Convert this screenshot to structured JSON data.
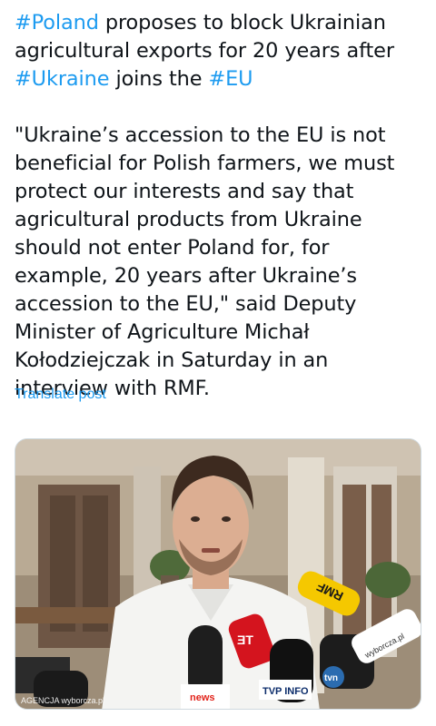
{
  "tweet": {
    "headline": {
      "seg1": "#Poland",
      "seg2": " proposes to block Ukrainian agricultural exports for 20 years after ",
      "seg3": "#Ukraine",
      "seg4": " joins the ",
      "seg5": "#EU"
    },
    "quote": "\"Ukraine’s accession to the EU is not beneficial for Polish farmers, we must protect our interests and say that agricultural products from Ukraine should not enter Poland for, for example, 20 years after Ukraine’s accession to the EU,\" said Deputy Minister of Agriculture Michał Kołodziejczak in Saturday in an interview with RMF.",
    "translate_label": "Translate post"
  },
  "media": {
    "photo_credit": "AGENCJA wyborcza.pl",
    "mic_labels": {
      "rmf": "RMF",
      "tvn": "tvn",
      "tvp": "TVP INFO",
      "news": "news",
      "wyborcza": "wyborcza.pl"
    }
  },
  "colors": {
    "hashtag": "#1d9bf0",
    "text": "#0f1419",
    "link": "#1d9bf0"
  }
}
